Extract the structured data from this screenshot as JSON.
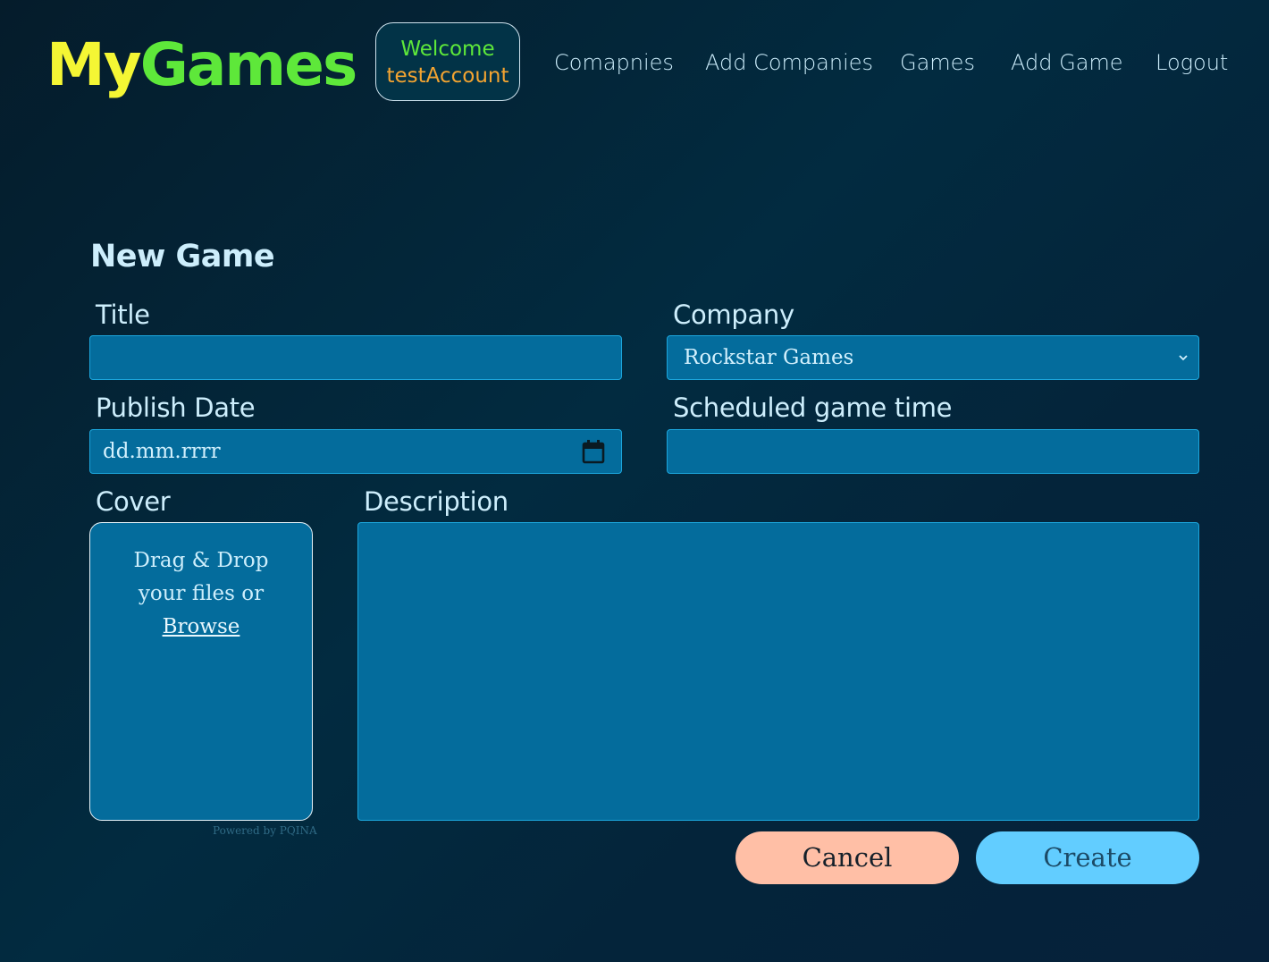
{
  "header": {
    "logo_part1": "My",
    "logo_part2": "Games",
    "welcome_line1": "Welcome",
    "welcome_line2": "testAccount"
  },
  "nav": {
    "items": [
      {
        "label": "Comapnies"
      },
      {
        "label": "Add Companies"
      },
      {
        "label": "Games"
      },
      {
        "label": "Add Game"
      },
      {
        "label": "Logout"
      }
    ]
  },
  "form": {
    "heading": "New Game",
    "title_label": "Title",
    "title_value": "",
    "company_label": "Company",
    "company_selected": "Rockstar Games",
    "publish_date_label": "Publish Date",
    "publish_date_placeholder": "dd.mm.rrrr",
    "scheduled_label": "Scheduled game time",
    "scheduled_value": "",
    "cover_label": "Cover",
    "cover_text": "Drag & Drop your files or",
    "cover_browse": "Browse",
    "cover_powered": "Powered by PQINA",
    "description_label": "Description",
    "description_value": "",
    "cancel_label": "Cancel",
    "create_label": "Create"
  },
  "colors": {
    "logo_my": "#f4f634",
    "logo_games": "#5ee83a",
    "welcome_user": "#f3a431",
    "field_bg": "#046c9c",
    "cancel_bg": "#ffbfa6",
    "create_bg": "#62cdff"
  },
  "icons": {
    "company_dropdown": "chevron-down-icon",
    "date_picker": "calendar-icon"
  }
}
